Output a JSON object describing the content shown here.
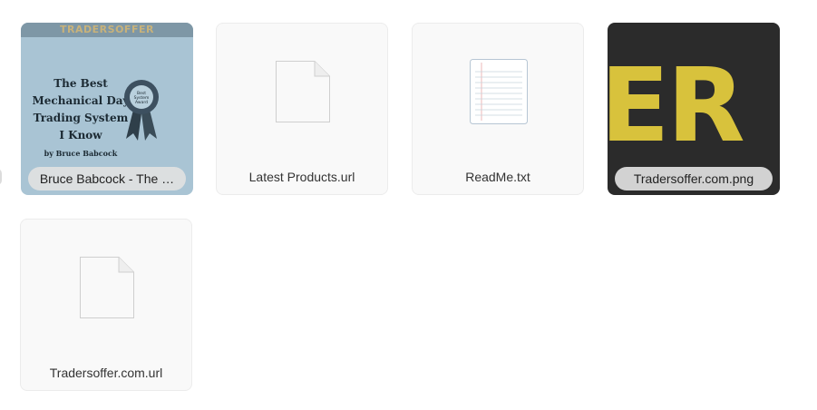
{
  "files": [
    {
      "name": "Bruce Babcock - The …",
      "type": "image-thumbnail",
      "thumbnail": {
        "banner": "TRADERS",
        "banner_suffix": "OFFER",
        "title_lines": [
          "The Best",
          "Mechanical Day",
          "Trading System",
          "I Know"
        ],
        "author": "by Bruce Babcock",
        "ribbon_text": "Best System Award"
      }
    },
    {
      "name": "Latest Products.url",
      "type": "generic-file",
      "icon": "blank-file-icon"
    },
    {
      "name": "ReadMe.txt",
      "type": "text-file",
      "icon": "text-file-icon"
    },
    {
      "name": "Tradersoffer.com.png",
      "type": "image-thumbnail",
      "thumbnail": {
        "text": "ER"
      }
    },
    {
      "name": "Tradersoffer.com.url",
      "type": "generic-file",
      "icon": "blank-file-icon"
    }
  ],
  "colors": {
    "tile_bg": "#f9f9f9",
    "book_cover": "#a9c4d4",
    "er_bg": "#2b2b2b",
    "er_text": "#d8c23c"
  }
}
